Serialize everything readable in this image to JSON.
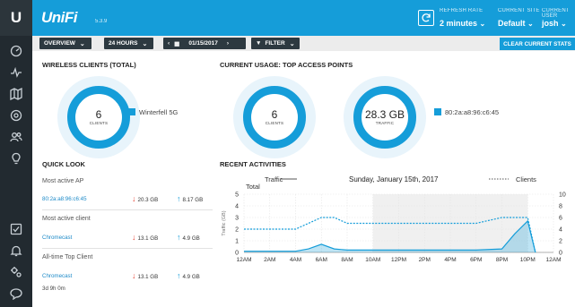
{
  "app": {
    "logo_letter": "U",
    "brand": "UniFi",
    "version": "5.3.9"
  },
  "header": {
    "refresh_label": "REFRESH RATE",
    "refresh_value": "2 minutes",
    "site_label": "CURRENT SITE",
    "site_value": "Default",
    "user_label": "CURRENT USER",
    "user_value": "josh"
  },
  "sidebar": {
    "items": [
      {
        "icon": "dashboard-icon"
      },
      {
        "icon": "statistics-icon"
      },
      {
        "icon": "map-icon"
      },
      {
        "icon": "devices-icon"
      },
      {
        "icon": "clients-icon"
      },
      {
        "icon": "insights-icon"
      },
      {
        "icon": "events-icon"
      },
      {
        "icon": "alerts-icon"
      },
      {
        "icon": "settings-icon"
      },
      {
        "icon": "chat-icon"
      }
    ]
  },
  "toolbar": {
    "overview": "OVERVIEW",
    "range": "24 HOURS",
    "date": "01/15/2017",
    "filter": "FILTER",
    "clear": "CLEAR CURRENT STATS"
  },
  "wireless": {
    "title": "WIRELESS CLIENTS (TOTAL)",
    "count": "6",
    "count_label": "CLIENTS",
    "legend": "Winterfell 5G"
  },
  "usage": {
    "title": "CURRENT USAGE: TOP ACCESS POINTS",
    "clients": "6",
    "clients_label": "CLIENTS",
    "traffic": "28.3 GB",
    "traffic_label": "TRAFFIC",
    "legend": "80:2a:a8:96:c6:45"
  },
  "quick_look": {
    "title": "QUICK LOOK",
    "rows": [
      {
        "heading": "Most active AP",
        "name": "80:2a:a8:96:c6:45",
        "down": "20.3 GB",
        "up": "8.17 GB",
        "extra": ""
      },
      {
        "heading": "Most active client",
        "name": "Chromecast",
        "down": "13.1 GB",
        "up": "4.9 GB",
        "extra": ""
      },
      {
        "heading": "All-time Top Client",
        "name": "Chromecast",
        "down": "13.1 GB",
        "up": "4.9 GB",
        "extra": "3d 9h 0m"
      }
    ]
  },
  "activities": {
    "title": "RECENT ACTIVITIES",
    "legend_traffic": "Traffic",
    "legend_total": "Total",
    "date": "Sunday, January 15th, 2017",
    "legend_clients": "Clients"
  },
  "colors": {
    "accent": "#159dd9",
    "sidebar": "#222a30",
    "toolbar_button": "#2d3940",
    "down_arrow": "#e84b3c"
  },
  "chart_data": {
    "type": "line",
    "categories": [
      "12AM",
      "2AM",
      "4AM",
      "6AM",
      "8AM",
      "10AM",
      "12PM",
      "2PM",
      "4PM",
      "6PM",
      "8PM",
      "10PM",
      "12AM"
    ],
    "ylabel": "Traffic (GB)",
    "ylim": [
      0,
      5
    ],
    "y2lim": [
      0,
      10
    ],
    "yticks": [
      0,
      1,
      2,
      3,
      4,
      5
    ],
    "y2ticks": [
      0,
      2,
      4,
      6,
      8,
      10
    ],
    "series": [
      {
        "name": "Traffic",
        "axis": "left",
        "style": "area",
        "x": [
          0,
          1,
          2,
          2.5,
          3,
          3.5,
          4,
          5,
          6,
          7,
          8,
          9,
          10,
          10.5,
          11,
          11.3
        ],
        "values": [
          0.1,
          0.1,
          0.1,
          0.3,
          0.7,
          0.3,
          0.2,
          0.2,
          0.2,
          0.2,
          0.2,
          0.2,
          0.3,
          1.6,
          2.7,
          0
        ]
      },
      {
        "name": "Clients",
        "axis": "right",
        "style": "dashed",
        "x": [
          0,
          1,
          2,
          3,
          3.5,
          4,
          5,
          6,
          7,
          8,
          9,
          10,
          10.5,
          11,
          11.3
        ],
        "values": [
          4,
          4,
          4,
          6,
          6,
          5,
          5,
          5,
          5,
          5,
          5,
          6,
          6,
          6,
          0
        ]
      }
    ],
    "grid": true,
    "legend_position": "top"
  }
}
